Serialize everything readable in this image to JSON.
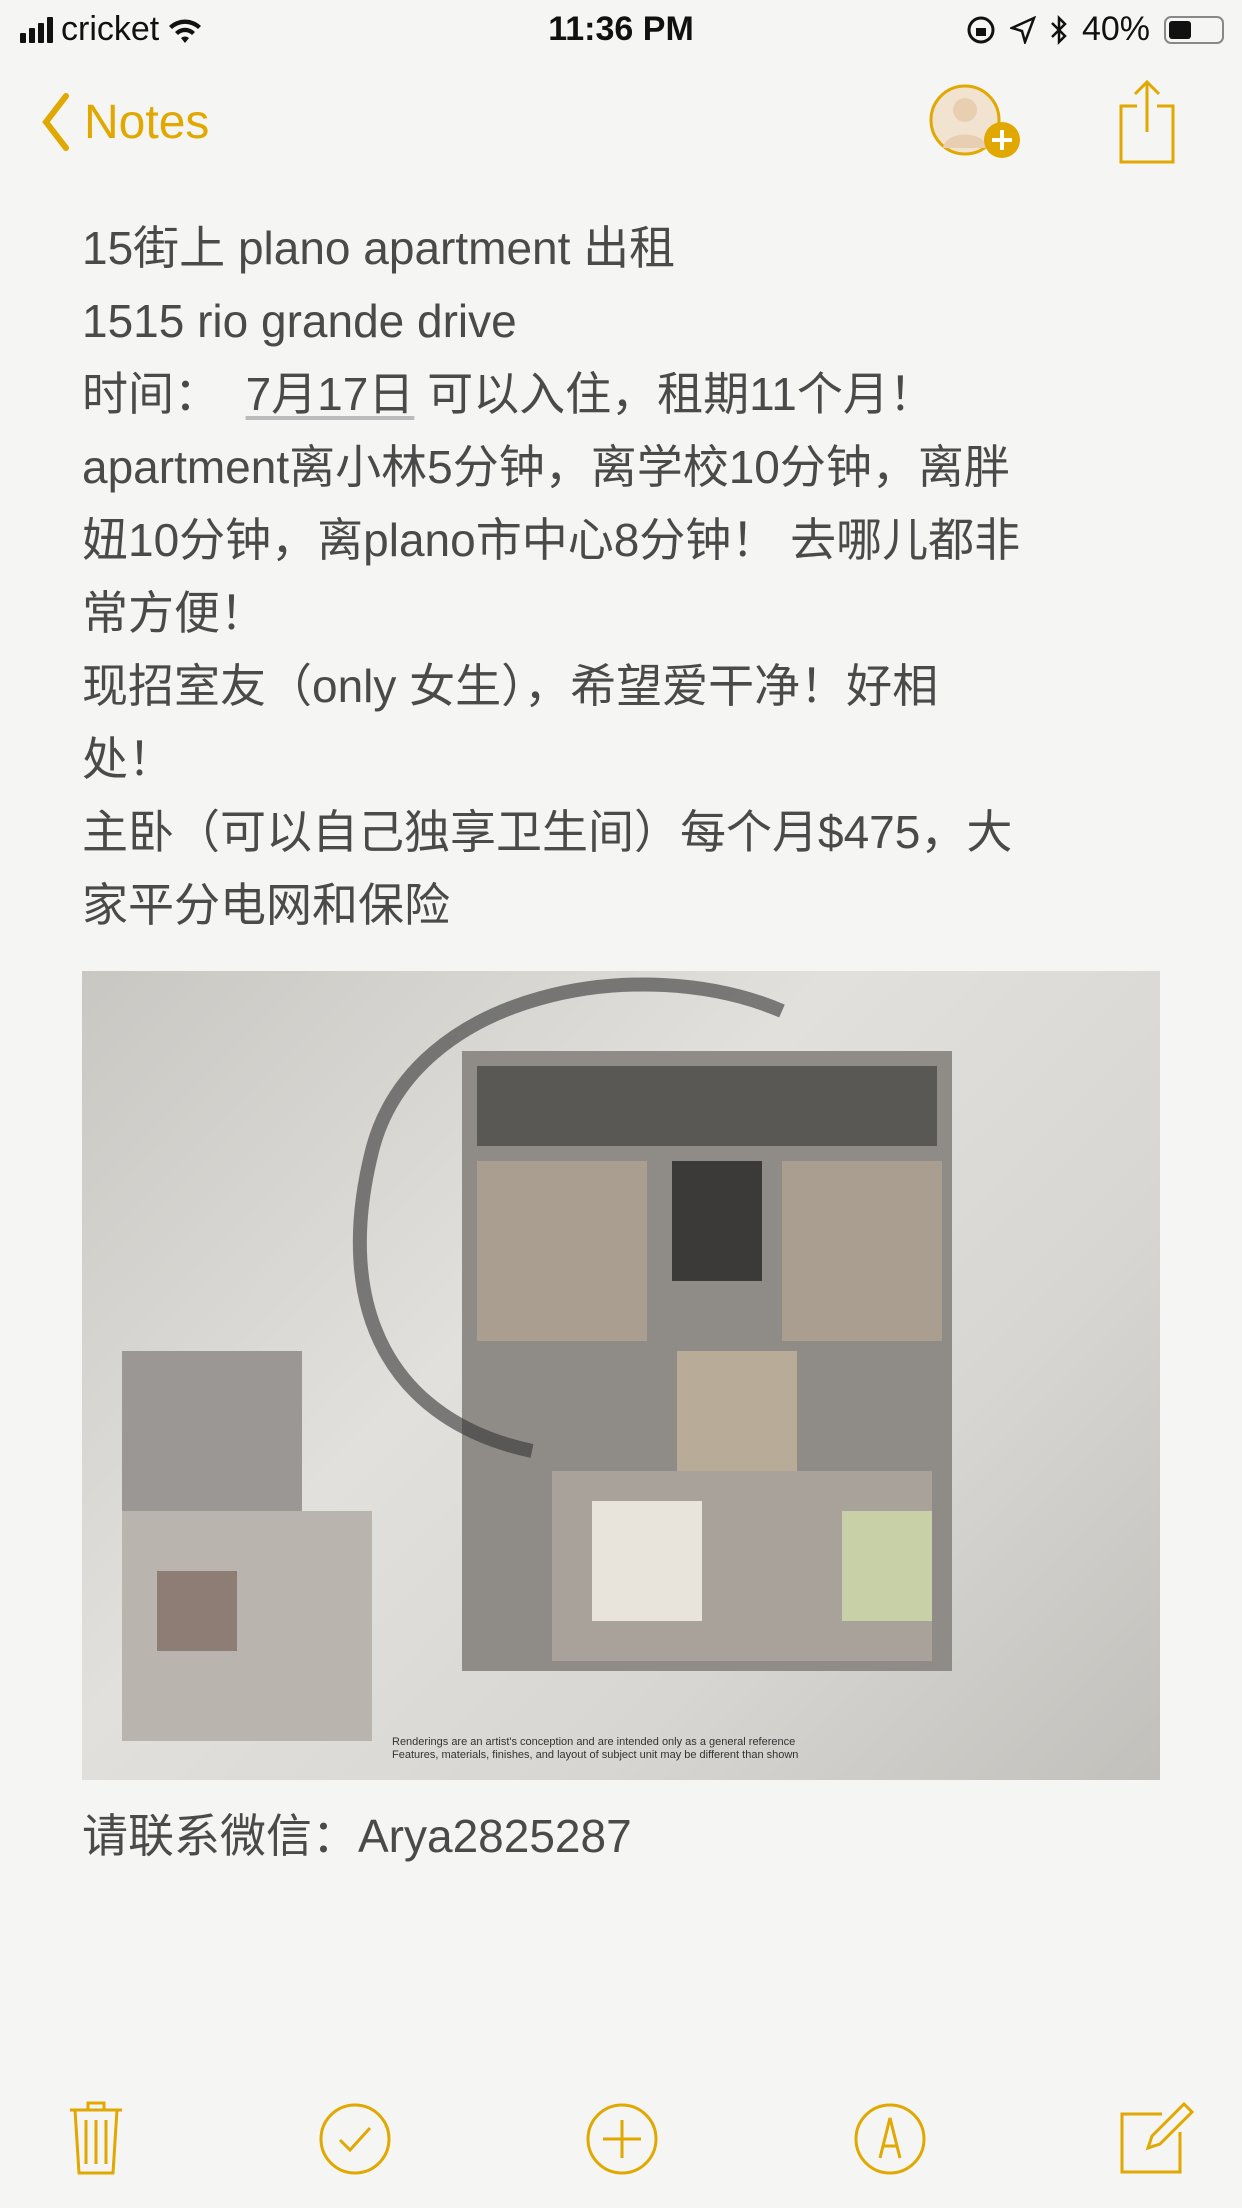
{
  "status_bar": {
    "carrier": "cricket",
    "time": "11:36 PM",
    "battery": "40%",
    "battery_level": 0.4
  },
  "nav": {
    "back_label": "Notes"
  },
  "note": {
    "lines": [
      "15街上 plano apartment 出租",
      "1515 rio grande drive",
      "时间：",
      "apartment离小林5分钟，离学校10分钟，离胖",
      "妞10分钟，离plano市中心8分钟！ 去哪儿都非",
      "常方便！",
      "现招室友（only 女生），希望爱干净！好相",
      "处！",
      "主卧（可以自己独享卫生间）每个月$475，大",
      "家平分电网和保险"
    ],
    "date_link": "7月17日",
    "date_line_rest": " 可以入住，租期11个月！",
    "image_caption_1": "Renderings are an artist's conception and are intended only as a general reference",
    "image_caption_2": "Features, materials, finishes, and layout of subject unit may be different than shown",
    "contact": "请联系微信：Arya2825287"
  },
  "accent_color": "#e0a800"
}
